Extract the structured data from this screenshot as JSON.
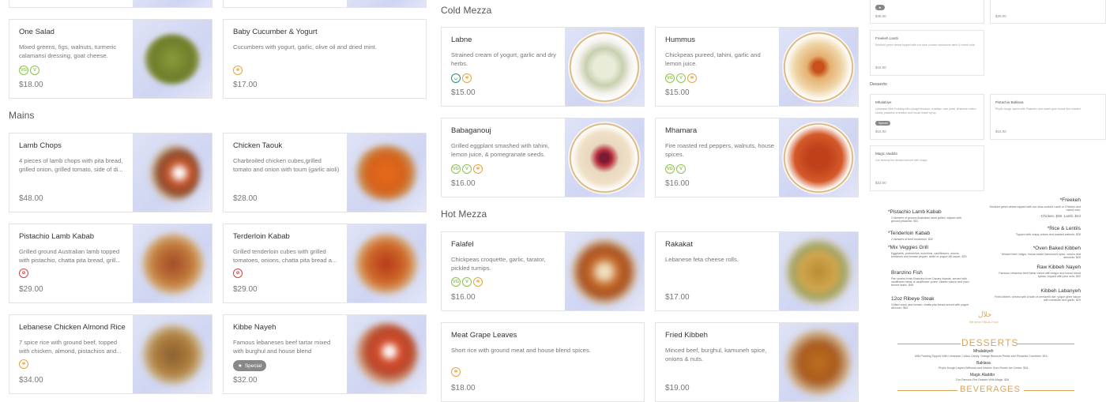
{
  "sections": {
    "mains": "Mains",
    "cold_mezza": "Cold Mezza",
    "hot_mezza": "Hot Mezza"
  },
  "cards": {
    "one_salad": {
      "name": "One Salad",
      "desc": "Mixed greens, figs, walnuts, turmeric calamansi dressing, goat cheese.",
      "price": "$18.00"
    },
    "baby_cucumber": {
      "name": "Baby Cucumber & Yogurt",
      "desc": "Cucumbers with yogurt, garlic, olive oil and dried mint.",
      "price": "$17.00"
    },
    "lamb_chops": {
      "name": "Lamb Chops",
      "desc": "4 pieces of lamb chops with pita bread, grilled onion, grilled tomato, side of di...",
      "price": "$48.00"
    },
    "chicken_taouk": {
      "name": "Chicken Taouk",
      "desc": "Charbroiled chicken cubes,grilled tomato and onion with toum (garlic aioli) & to...",
      "price": "$28.00"
    },
    "pistachio_lamb": {
      "name": "Pistachio Lamb Kabab",
      "desc": "Grilled ground Australian lamb topped with pistachio, chatta pita bread, grill...",
      "price": "$29.00"
    },
    "tenderloin": {
      "name": "Terderloin Kabab",
      "desc": "Grilled tenderloin cubes with grilled tomatoes, onions, chatta pita bread a...",
      "price": "$29.00"
    },
    "lebanese_chicken": {
      "name": "Lebanese Chicken Almond Rice",
      "desc": "7 spice rice with ground beef, topped with chicken, almond, pistachios and...",
      "price": "$34.00"
    },
    "kibbe_nayeh": {
      "name": "Kibbe Nayeh",
      "desc": "Famous lebaneses beef tartar mixed with burghul and house blend kammoune.",
      "price": "$32.00",
      "badge": "Special"
    },
    "labne": {
      "name": "Labne",
      "desc": "Strained cream of yogurt, garlic and dry herbs.",
      "price": "$15.00"
    },
    "hummus": {
      "name": "Hummus",
      "desc": "Chickpeas pureed, tahini, garlic and lemon juice.",
      "price": "$15.00"
    },
    "babaganouj": {
      "name": "Babaganouj",
      "desc": "Grilled eggplant smashed with tahini, lemon juice, & pomegranate seeds.",
      "price": "$16.00"
    },
    "mhamara": {
      "name": "Mhamara",
      "desc": "Fire roasted red peppers, walnuts, house spices.",
      "price": "$16.00"
    },
    "falafel": {
      "name": "Falafel",
      "desc": "Chickpeas croquette, garlic, tarator, pickled turnips.",
      "price": "$16.00"
    },
    "rakakat": {
      "name": "Rakakat",
      "desc": "Lebanese feta cheese rolls.",
      "price": "$17.00"
    },
    "meat_grape": {
      "name": "Meat Grape Leaves",
      "desc": "Short rice with ground meat and house blend spices.",
      "price": "$18.00"
    },
    "fried_kibbeh": {
      "name": "Fried Kibbeh",
      "desc": "Minced beef, burghul, kamuneh spice, onions & nuts.",
      "price": "$19.00"
    }
  },
  "icons": {
    "vg": "VG",
    "v": "V",
    "wheat": "wheat-icon",
    "nut": "nut-icon",
    "dairy": "dairy-icon",
    "star": "★"
  },
  "thumb": {
    "desserts_label": "Desserts",
    "freekeh_lamb": {
      "name": "Freekeh Lamb",
      "desc": "Smoked green wheat topped with our slow cooked cardamom lamb & mixed nuts.",
      "price": "$42.00"
    },
    "mhalabiye": {
      "name": "Mhalabiye",
      "desc": "Lebanese Milk Pudding with orange blossom, mastika, rose petal, lebanese cotton candy, pistachio crumbles and house made syrup.",
      "price": "$16.00",
      "badge": "Special"
    },
    "pistachio_baklava": {
      "name": "Pistachio Baklava",
      "desc": "Phyllo dough layers with Pistachio and rosem gum house line roasted.",
      "price": "$16.00"
    },
    "magic_aladdin": {
      "name": "Magic Aladdin",
      "desc": "Our famous fire dessert served with magic.",
      "price": "$32.00"
    },
    "top_price_1": "$48.00",
    "top_price_2": "$29.00"
  },
  "print_menu": {
    "freekeh": "*Freekeh",
    "freekeh_desc": "Smoked green wheat topped with our slow cooked Lamb or Chicken and mixed nuts.",
    "freekeh_prices": "-Chicken. $38  -Lamb. $44",
    "pistachio": "*Pistachio Lamb Kabab",
    "pistachio_desc": "2 skewers of ground Australian lamb grilled, topped with ground pistachio. $31",
    "rice": "*Rice & Lentils",
    "rice_desc": "Topped with crispy onions and toasted walnuts. $26",
    "tenderloin": "*Tenderloin Kabab",
    "tenderloin_desc": "2 skewers of beef tenderloin. $32",
    "mix": "*Mix Veggies Grill",
    "mix_desc": "Eggplants, portobellos, zucchinis, cauliflowers, onions, tomatoes and tomato pepper. tahini or yogurt dill sauce. $29",
    "oven": "*Oven Baked Kibbeh",
    "oven_desc": "Minced beef, bulgur, house-made kamooneh spice, onions and almonds. $29",
    "raw": "Raw Kibbeh Nayeh",
    "raw_desc": "Famous Lebanese beef tartar mixed with bulgur and house blend spices, topped with pine nuts. $32",
    "branzino": "Branzino Fish",
    "branzino_desc": "Pan seared fresh Branzino from Canary Islands, served with cauliflower steak or cauliflower puree, cilantro sauce and yuzu beurre blanc. $48",
    "labneyeh": "Kibbeh Labanyeh",
    "labneyeh_desc": "Fried kibbeh, served with a side of vermicelli rice, yogurt ghee sauce with coriander and garlic. $29",
    "ribeye": "12oz Ribeye Steak",
    "ribeye_desc": "Grilled onion and tomato, chatta pita bread served with yogurt dill toum. $52",
    "halal": "حلال",
    "halal_sub": "We serve HALAL Food",
    "desserts": "DESSERTS",
    "mhalabiyeh": "Mhalabiyeh",
    "mhalabiyeh_desc": "Milk Pudding Topped With Lebanese Cotton Candy, Orange Blossom Petals and Pistachio Crumbles. $16",
    "baklava": "Baklava",
    "baklava_desc": "Phyllo Dough Layers Withnuts and Infantic Gum Roses Ice Cream. $16",
    "magic": "Magic Aladdin",
    "magic_desc": "Our Famous Fire Dessert With Magic. $28",
    "beverages": "BEVERAGES"
  }
}
